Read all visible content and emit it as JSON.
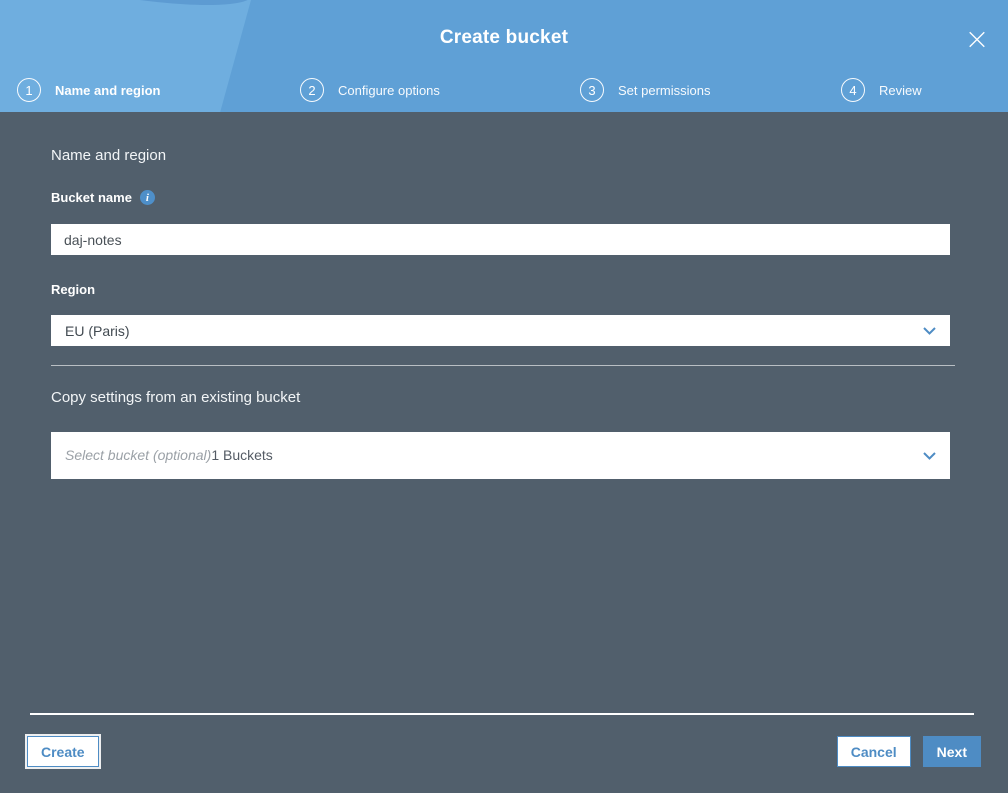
{
  "modal": {
    "title": "Create bucket"
  },
  "steps": [
    {
      "number": "1",
      "label": "Name and region",
      "active": true
    },
    {
      "number": "2",
      "label": "Configure options",
      "active": false
    },
    {
      "number": "3",
      "label": "Set permissions",
      "active": false
    },
    {
      "number": "4",
      "label": "Review",
      "active": false
    }
  ],
  "form": {
    "section_heading": "Name and region",
    "bucket_name_label": "Bucket name",
    "bucket_name_value": "daj-notes",
    "info_icon_glyph": "i",
    "region_label": "Region",
    "region_value": "EU (Paris)",
    "copy_settings_heading": "Copy settings from an existing bucket",
    "bucket_select_placeholder": "Select bucket (optional)",
    "bucket_select_count": "1 Buckets"
  },
  "footer": {
    "create_label": "Create",
    "cancel_label": "Cancel",
    "next_label": "Next"
  },
  "colors": {
    "header_blue": "#5FA0D6",
    "body_slate": "#515F6C",
    "accent_blue": "#4E8CC4",
    "watermark_fill": "#6FAEDF",
    "watermark_outline": "#5896CE"
  }
}
